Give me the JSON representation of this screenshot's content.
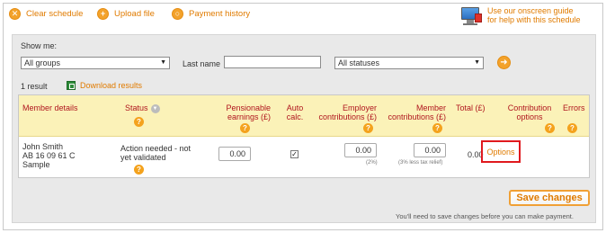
{
  "toolbar": {
    "clear_schedule": "Clear schedule",
    "upload_file": "Upload file",
    "payment_history": "Payment history",
    "guide_line1": "Use our onscreen guide",
    "guide_line2": "for help with this schedule"
  },
  "filters": {
    "show_me_label": "Show me:",
    "group_select": "All groups",
    "last_name_label": "Last name",
    "last_name_value": "",
    "status_select": "All statuses"
  },
  "results": {
    "count": "1 result",
    "download": "Download results"
  },
  "table": {
    "headers": {
      "member_details": "Member details",
      "status": "Status",
      "pensionable_1": "Pensionable",
      "pensionable_2": "earnings (£)",
      "auto_1": "Auto",
      "auto_2": "calc.",
      "employer_1": "Employer",
      "employer_2": "contributions (£)",
      "member_1": "Member",
      "member_2": "contributions (£)",
      "total": "Total (£)",
      "contrib_1": "Contribution",
      "contrib_2": "options",
      "errors": "Errors"
    },
    "row": {
      "name": "John Smith",
      "ni": "AB 16 09 61 C",
      "group": "Sample",
      "status_1": "Action needed - not",
      "status_2": "yet validated",
      "pensionable": "0.00",
      "auto_calc": true,
      "employer": "0.00",
      "employer_note": "(2%)",
      "member": "0.00",
      "member_note": "(3% less tax relief)",
      "total": "0.00",
      "options": "Options"
    }
  },
  "save": {
    "label": "Save changes",
    "note": "You'll need to save changes before you can make payment."
  },
  "colors": {
    "accent": "#e07b00",
    "header_bg": "#fbf2b8",
    "header_text": "#b0161e",
    "highlight": "#e0191e"
  }
}
